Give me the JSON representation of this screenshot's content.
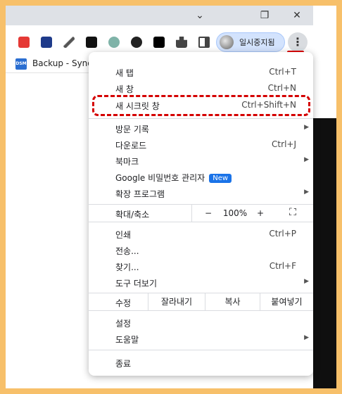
{
  "titlebar": {
    "minimize": "⌄",
    "restore": "❐",
    "close": "✕"
  },
  "toolbar": {
    "profile_label": "일시중지됨",
    "menu_icon": "⋮"
  },
  "bookmarks": {
    "icon_text": "DSM",
    "label": "Backup - Syno"
  },
  "menu": {
    "new_tab": {
      "label": "새 탭",
      "shortcut": "Ctrl+T"
    },
    "new_window": {
      "label": "새 창",
      "shortcut": "Ctrl+N"
    },
    "incognito": {
      "label": "새 시크릿 창",
      "shortcut": "Ctrl+Shift+N"
    },
    "history": {
      "label": "방문 기록"
    },
    "downloads": {
      "label": "다운로드",
      "shortcut": "Ctrl+J"
    },
    "bookmarks": {
      "label": "북마크"
    },
    "passwords": {
      "label": "Google 비밀번호 관리자",
      "badge": "New"
    },
    "extensions": {
      "label": "확장 프로그램"
    },
    "zoom": {
      "label": "확대/축소",
      "minus": "−",
      "value": "100%",
      "plus": "+",
      "fullscreen": "⛶"
    },
    "print": {
      "label": "인쇄",
      "shortcut": "Ctrl+P"
    },
    "cast": {
      "label": "전송..."
    },
    "find": {
      "label": "찾기...",
      "shortcut": "Ctrl+F"
    },
    "more_tools": {
      "label": "도구 더보기"
    },
    "edit": {
      "label": "수정",
      "cut": "잘라내기",
      "copy": "복사",
      "paste": "붙여넣기"
    },
    "settings": {
      "label": "설정"
    },
    "help": {
      "label": "도움말"
    },
    "exit": {
      "label": "종료"
    }
  },
  "colors": {
    "accent": "#1a73e8",
    "highlight": "#d40000",
    "frame": "#f7c06a"
  }
}
